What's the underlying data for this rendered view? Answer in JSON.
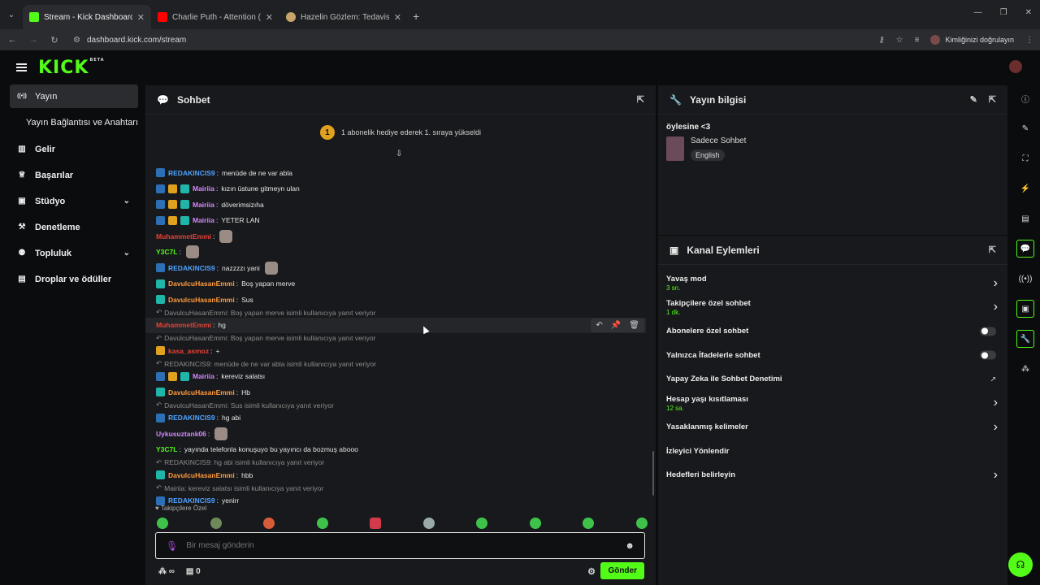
{
  "browser": {
    "tabs": [
      {
        "title": "Stream - Kick Dashboard",
        "favicon_color": "#53fc18"
      },
      {
        "title": "Charlie Puth - Attention (Lyrics",
        "favicon_color": "#ff0000"
      },
      {
        "title": "Hazelin Gözlem: Tedavisi",
        "favicon_color": "#c8a46a"
      }
    ],
    "url": "dashboard.kick.com/stream",
    "profile_label": "Kimliğinizi doğrulayın"
  },
  "app": {
    "logo": "KICK",
    "logo_tag": "BETA"
  },
  "sidebar": {
    "items": [
      {
        "label": "Yayın",
        "icon": "broadcast-icon",
        "glyph": "((•))"
      },
      {
        "label": "Yayın Bağlantısı ve Anahtarı",
        "icon": "",
        "glyph": ""
      },
      {
        "label": "Gelir",
        "icon": "chart-icon",
        "glyph": "▥"
      },
      {
        "label": "Başarılar",
        "icon": "trophy-icon",
        "glyph": "♕"
      },
      {
        "label": "Stüdyo",
        "icon": "studio-icon",
        "glyph": "▣"
      },
      {
        "label": "Denetleme",
        "icon": "hammer-icon",
        "glyph": "⚒"
      },
      {
        "label": "Topluluk",
        "icon": "community-icon",
        "glyph": "👥"
      },
      {
        "label": "Droplar ve ödüller",
        "icon": "gift-icon",
        "glyph": "🎁"
      }
    ]
  },
  "chat": {
    "title": "Sohbet",
    "pinned_text": "1 abonelik hediye ederek 1. sıraya yükseldi",
    "pinned_badge": "1",
    "messages": [
      {
        "type": "msg",
        "user": "REDAKINCIS9",
        "color": "#4da3ff",
        "text": "menüde de ne var abla",
        "badges": [
          "#2d6fb5"
        ]
      },
      {
        "type": "msg",
        "user": "Mairiia",
        "color": "#d28aff",
        "text": "kızın üstune gitmeyn ulan",
        "badges": [
          "#2d6fb5",
          "#e0a11e",
          "#1fb5a8"
        ]
      },
      {
        "type": "msg",
        "user": "Mairiia",
        "color": "#d28aff",
        "text": "döverimsizıha",
        "badges": [
          "#2d6fb5",
          "#e0a11e",
          "#1fb5a8"
        ]
      },
      {
        "type": "msg",
        "user": "Mairiia",
        "color": "#d28aff",
        "text": "YETER LAN",
        "badges": [
          "#2d6fb5",
          "#e0a11e",
          "#1fb5a8"
        ]
      },
      {
        "type": "msg",
        "user": "MuhammetEmmi",
        "color": "#e0443a",
        "text": "",
        "badges": [],
        "emote": true
      },
      {
        "type": "msg",
        "user": "Y3C7L",
        "color": "#53fc18",
        "text": "",
        "badges": [],
        "emote": true
      },
      {
        "type": "msg",
        "user": "REDAKINCIS9",
        "color": "#4da3ff",
        "text": "nazzzzı yani",
        "badges": [
          "#2d6fb5"
        ],
        "emote": true
      },
      {
        "type": "msg",
        "user": "DavulcuHasanEmmi",
        "color": "#ff9a3c",
        "text": "Boş yapan merve",
        "badges": [
          "#1fb5a8"
        ]
      },
      {
        "type": "msg",
        "user": "DavulcuHasanEmmi",
        "color": "#ff9a3c",
        "text": "Sus",
        "badges": [
          "#1fb5a8"
        ]
      },
      {
        "type": "reply",
        "text": "DavulcuHasanEmmi: Boş yapan merve isimli kullanıcıya yanıt veriyor"
      },
      {
        "type": "msg",
        "user": "MuhammetEmmi",
        "color": "#e0443a",
        "text": "hg",
        "badges": [],
        "hover": true
      },
      {
        "type": "reply",
        "text": "DavulcuHasanEmmi: Boş yapan merve isimli kullanıcıya yanıt veriyor"
      },
      {
        "type": "msg",
        "user": "kasa_asmoz",
        "color": "#e0443a",
        "text": "+",
        "badges": [
          "#e0a11e"
        ]
      },
      {
        "type": "reply",
        "text": "REDAKINCIS9: menüde de ne var abla isimli kullanıcıya yanıt veriyor"
      },
      {
        "type": "msg",
        "user": "Mairiia",
        "color": "#d28aff",
        "text": "kereviz salatsı",
        "badges": [
          "#2d6fb5",
          "#e0a11e",
          "#1fb5a8"
        ]
      },
      {
        "type": "msg",
        "user": "DavulcuHasanEmmi",
        "color": "#ff9a3c",
        "text": "Hb",
        "badges": [
          "#1fb5a8"
        ]
      },
      {
        "type": "reply",
        "text": "DavulcuHasanEmmi: Sus isimli kullanıcıya yanıt veriyor"
      },
      {
        "type": "msg",
        "user": "REDAKINCIS9",
        "color": "#4da3ff",
        "text": "hg abi",
        "badges": [
          "#2d6fb5"
        ]
      },
      {
        "type": "msg",
        "user": "Uykusuztank06",
        "color": "#d28aff",
        "text": "",
        "badges": [],
        "emote": true
      },
      {
        "type": "msg",
        "user": "Y3C7L",
        "color": "#53fc18",
        "text": "yayında telefonla konuşuyo bu yayıncı da bozmuş abooo",
        "badges": []
      },
      {
        "type": "reply",
        "text": "REDAKINCIS9: hg abi isimli kullanıcıya yanıt veriyor"
      },
      {
        "type": "msg",
        "user": "DavulcuHasanEmmi",
        "color": "#ff9a3c",
        "text": "hbb",
        "badges": [
          "#1fb5a8"
        ]
      },
      {
        "type": "reply",
        "text": "Mairiia: kereviz salatsı isimli kullanıcıya yanıt veriyor"
      },
      {
        "type": "msg",
        "user": "REDAKINCIS9",
        "color": "#4da3ff",
        "text": "yenirr",
        "badges": [
          "#2d6fb5"
        ]
      }
    ],
    "followers_only_label": "Takipçilere Özel",
    "input_placeholder": "Bir mesaj gönderin",
    "footer_infinity": "∞",
    "footer_count": "0",
    "send_label": "Gönder"
  },
  "stream_info": {
    "title": "Yayın bilgisi",
    "stream_title": "öylesine <3",
    "category": "Sadece Sohbet",
    "language": "English"
  },
  "channel_actions": {
    "title": "Kanal Eylemleri",
    "items": [
      {
        "label": "Yavaş mod",
        "sub": "3 sn.",
        "control": "chevron"
      },
      {
        "label": "Takipçilere özel sohbet",
        "sub": "1 dk.",
        "control": "chevron"
      },
      {
        "label": "Abonelere özel sohbet",
        "sub": "",
        "control": "toggle"
      },
      {
        "label": "Yalnızca İfadelerle sohbet",
        "sub": "",
        "control": "toggle"
      },
      {
        "label": "Yapay Zeka ile Sohbet Denetimi",
        "sub": "",
        "control": "external"
      },
      {
        "label": "Hesap yaşı kısıtlaması",
        "sub": "12 sa.",
        "control": "chevron"
      },
      {
        "label": "Yasaklanmış kelimeler",
        "sub": "",
        "control": "chevron"
      },
      {
        "label": "İzleyici Yönlendir",
        "sub": "",
        "control": "none"
      },
      {
        "label": "Hedefleri belirleyin",
        "sub": "",
        "control": "chevron"
      }
    ]
  },
  "colors": {
    "accent": "#53fc18"
  }
}
